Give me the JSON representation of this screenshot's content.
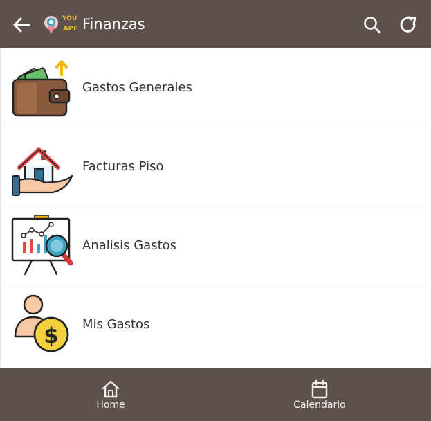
{
  "header": {
    "title": "Finanzas",
    "logo_text": "YOUR APP"
  },
  "items": [
    {
      "label": "Gastos Generales",
      "icon": "wallet-icon"
    },
    {
      "label": "Facturas Piso",
      "icon": "house-hand-icon"
    },
    {
      "label": "Analisis Gastos",
      "icon": "chart-magnifier-icon"
    },
    {
      "label": "Mis Gastos",
      "icon": "person-dollar-icon"
    }
  ],
  "bottom_nav": {
    "tabs": [
      {
        "label": "Home",
        "icon": "home-icon"
      },
      {
        "label": "Calendario",
        "icon": "calendar-icon"
      }
    ]
  },
  "colors": {
    "bar": "#5e504b",
    "text": "#333333"
  }
}
